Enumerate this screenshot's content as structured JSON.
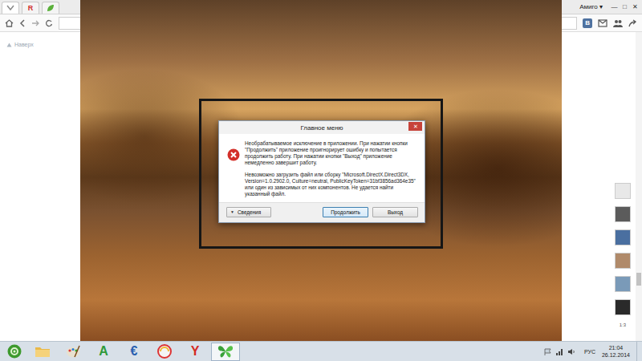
{
  "browser": {
    "tabs": [
      {
        "kind": "chevron",
        "selected": true
      },
      {
        "kind": "letter",
        "label": "R",
        "color": "#d0312d",
        "selected": false
      },
      {
        "kind": "leaf",
        "selected": false
      }
    ],
    "profile": "Амиго ▾",
    "window_controls": [
      "—",
      "□",
      "✕"
    ],
    "toolbar_badge": "В",
    "back_to_top": "Наверх"
  },
  "side_panel": {
    "avatars": [
      {
        "color": "#e8e8e8"
      },
      {
        "color": "#5b5b5b"
      },
      {
        "color": "#4a6fa0"
      },
      {
        "color": "#b08a6a"
      },
      {
        "color": "#7a9ab8"
      },
      {
        "color": "#2a2a2a"
      }
    ],
    "counter": "1:3"
  },
  "dialog": {
    "title": "Главное меню",
    "close": "✕",
    "message": "Необрабатываемое исключение в приложении. При нажатии кнопки \"Продолжить\" приложение проигнорирует ошибку и попытается продолжить работу. При нажатии кнопки \"Выход\" приложение немедленно завершит работу.",
    "details": "Невозможно загрузить файл или сборку \"Microsoft.DirectX.Direct3DX, Version=1.0.2902.0, Culture=neutral, PublicKeyToken=31bf3856ad364e35\" или один из зависимых от них компонентов. Не удается найти указанный файл.",
    "details_toggle": {
      "label": "Сведения",
      "icon": "▼",
      "expanded": false
    },
    "buttons": [
      {
        "label": "Продолжить",
        "selected": true
      },
      {
        "label": "Выход",
        "selected": false
      }
    ]
  },
  "taskbar": {
    "apps": [
      {
        "kind": "start",
        "selected": false
      },
      {
        "kind": "folder",
        "selected": false
      },
      {
        "kind": "paint",
        "selected": false
      },
      {
        "kind": "letter",
        "glyph": "A",
        "color": "#2f9a3a",
        "selected": false
      },
      {
        "kind": "letter",
        "glyph": "€",
        "color": "#2a5fb0",
        "selected": false
      },
      {
        "kind": "globe",
        "selected": false
      },
      {
        "kind": "letter",
        "glyph": "Y",
        "color": "#d42a20",
        "selected": false
      },
      {
        "kind": "butterfly",
        "selected": true
      }
    ],
    "tray": {
      "language": "РУС",
      "time": "21:04",
      "date": "26.12.2014"
    }
  }
}
